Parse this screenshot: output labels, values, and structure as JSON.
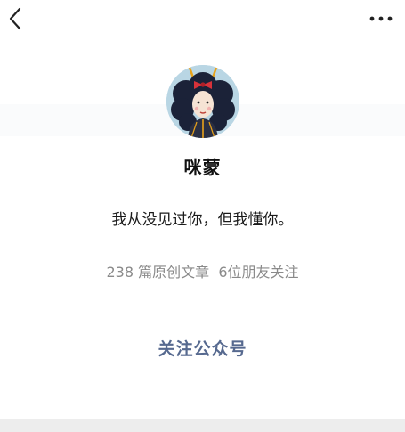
{
  "header": {
    "back_icon": "chevron-left-icon",
    "more_icon": "more-horizontal-icon"
  },
  "profile": {
    "avatar": "cartoon-girl-avatar",
    "name": "咪蒙",
    "bio": "我从没见过你，但我懂你。",
    "stats": {
      "articles_count": "238",
      "articles_label": "篇原创文章",
      "friends_count": "6",
      "friends_label": "位朋友关注"
    }
  },
  "actions": {
    "follow_label": "关注公众号"
  },
  "colors": {
    "follow_text": "#56698f",
    "stats_text": "#8a8a8a",
    "divider": "#ededed"
  }
}
